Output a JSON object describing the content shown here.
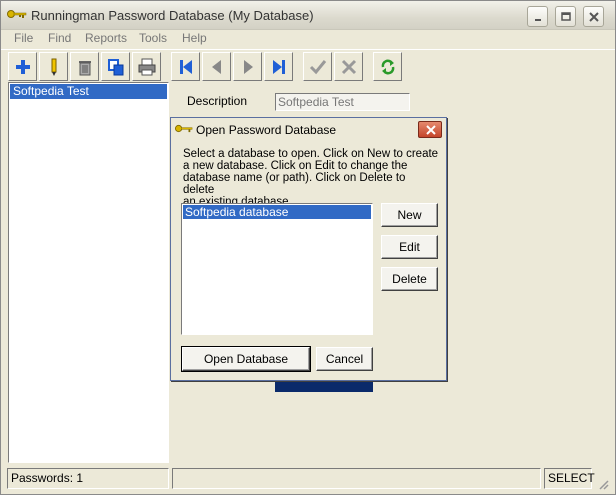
{
  "window": {
    "title": "Runningman Password Database (My Database)"
  },
  "menu": [
    "File",
    "Find",
    "Reports",
    "Tools",
    "Help"
  ],
  "toolbar": {
    "icons": [
      "add-icon",
      "edit-icon",
      "delete-icon",
      "copy-icon",
      "print-icon",
      "first-icon",
      "previous-icon",
      "next-icon",
      "last-icon",
      "accept-icon",
      "cancel-icon",
      "refresh-icon"
    ]
  },
  "left_list": {
    "items": [
      "Softpedia Test"
    ]
  },
  "detail": {
    "description_label": "Description",
    "description_value": "Softpedia Test"
  },
  "dialog": {
    "title": "Open Password Database",
    "instructions_lines": [
      "Select a database to open.  Click on New to create",
      "a new database.  Click on Edit to change the",
      "database name (or path).  Click on Delete to delete",
      "an existing database."
    ],
    "databases": [
      "Softpedia database"
    ],
    "new_label": "New",
    "edit_label": "Edit",
    "delete_label": "Delete",
    "open_label": "Open Database",
    "cancel_label": "Cancel"
  },
  "statusbar": {
    "passwords": "Passwords: 1",
    "middle": "",
    "mode": "SELECT"
  },
  "colors": {
    "selection": "#316ac5",
    "face": "#ece9d8"
  }
}
